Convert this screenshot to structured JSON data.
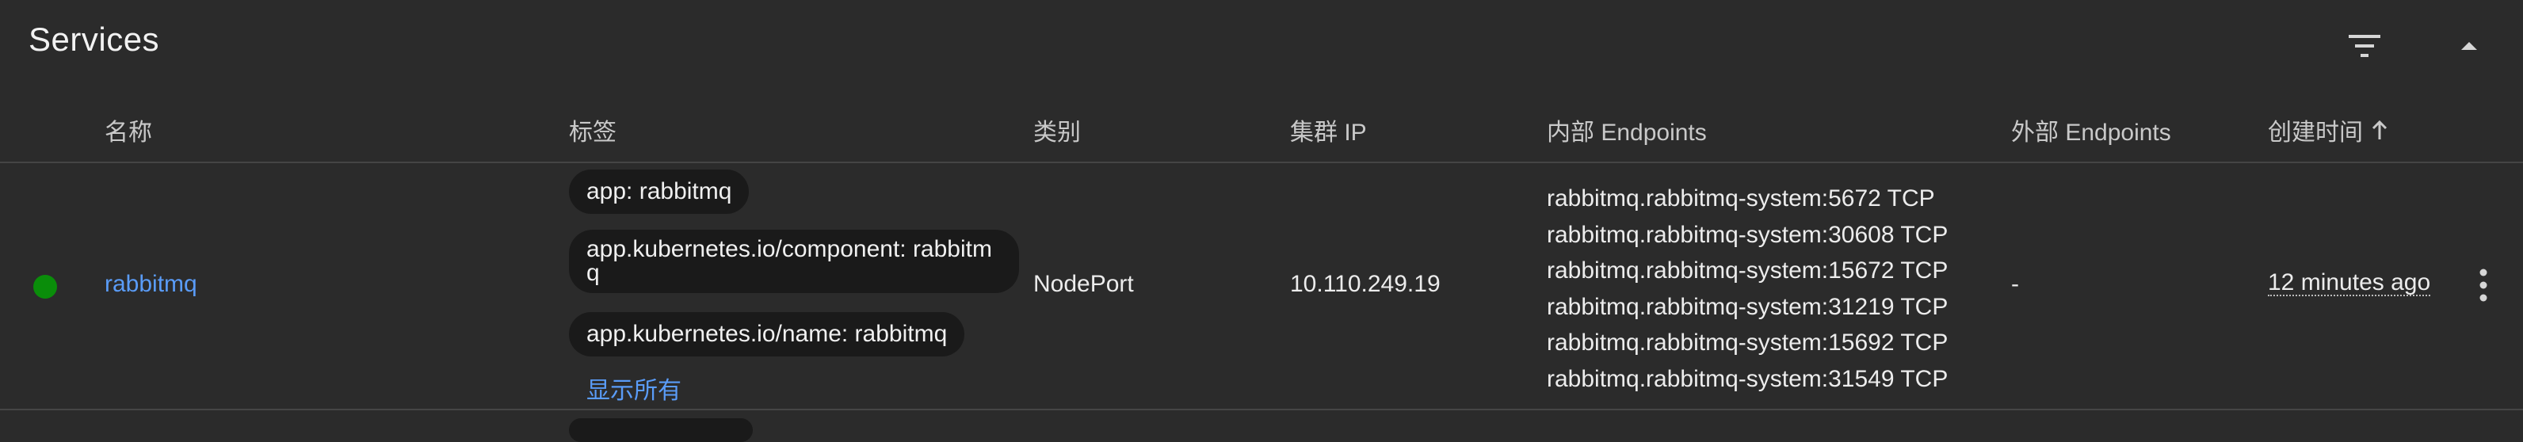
{
  "section": {
    "title": "Services"
  },
  "columns": {
    "name": "名称",
    "labels": "标签",
    "type": "类别",
    "cluster_ip": "集群 IP",
    "internal_endpoints": "内部 Endpoints",
    "external_endpoints": "外部 Endpoints",
    "created": "创建时间"
  },
  "rows": [
    {
      "status": "running",
      "name": "rabbitmq",
      "labels": [
        "app: rabbitmq",
        "app.kubernetes.io/component: rabbitmq",
        "app.kubernetes.io/name: rabbitmq"
      ],
      "show_all": "显示所有",
      "type": "NodePort",
      "cluster_ip": "10.110.249.19",
      "internal_endpoints": [
        "rabbitmq.rabbitmq-system:5672 TCP",
        "rabbitmq.rabbitmq-system:30608 TCP",
        "rabbitmq.rabbitmq-system:15672 TCP",
        "rabbitmq.rabbitmq-system:31219 TCP",
        "rabbitmq.rabbitmq-system:15692 TCP",
        "rabbitmq.rabbitmq-system:31549 TCP"
      ],
      "external_endpoints": "-",
      "created": "12 minutes ago"
    }
  ],
  "colors": {
    "background": "#2b2b2b",
    "link": "#5a9cf8",
    "status_ok": "#0a8d0a",
    "chip": "#1a1a1a"
  },
  "icons": {
    "filter": "filter-icon",
    "collapse": "collapse-up-icon",
    "sort": "arrow-up-icon",
    "more": "more-vert-icon"
  }
}
